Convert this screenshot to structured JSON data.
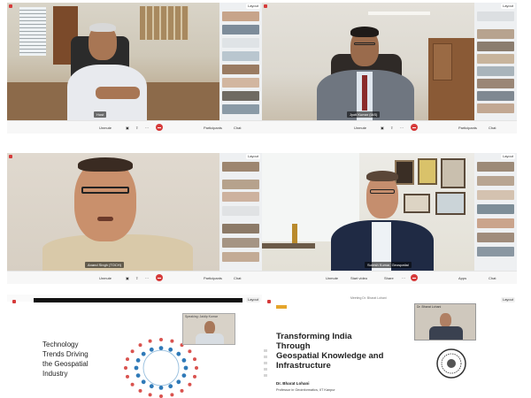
{
  "toolbar": {
    "unmute": "Unmute",
    "start_video": "Start video",
    "share": "Share",
    "participants": "Participants",
    "chat": "Chat",
    "apps": "Apps"
  },
  "layout_label": "Layout",
  "panels": [
    {
      "nameplate": "Host"
    },
    {
      "nameplate": "Jyoti Kumar (IAS)"
    },
    {
      "nameplate": "Anand Singh (TOCH)"
    },
    {
      "nameplate": "Suresh Kumar, Geospatial"
    }
  ],
  "slide1": {
    "title_lines": [
      "Technology",
      "Trends Driving",
      "the Geospatial",
      "Industry"
    ],
    "presenter_tag": "Speaking: Jaidip Kumar"
  },
  "slide2": {
    "title_lines": [
      "Transforming India",
      "Through",
      "Geospatial Knowledge and",
      "Infrastructure"
    ],
    "author": "Dr. Bharat Lohani",
    "affiliation": "Professor in Geoinformatics, IIT Kanpur",
    "presenter_tag": "Dr. Bharat Lohani",
    "header_text": "Meeting Dr. Bharat Lohani"
  },
  "colors": {
    "end_button": "#d63a3a",
    "rail_bg": "#eef0f2",
    "bar_bg": "#f7f7f7"
  }
}
